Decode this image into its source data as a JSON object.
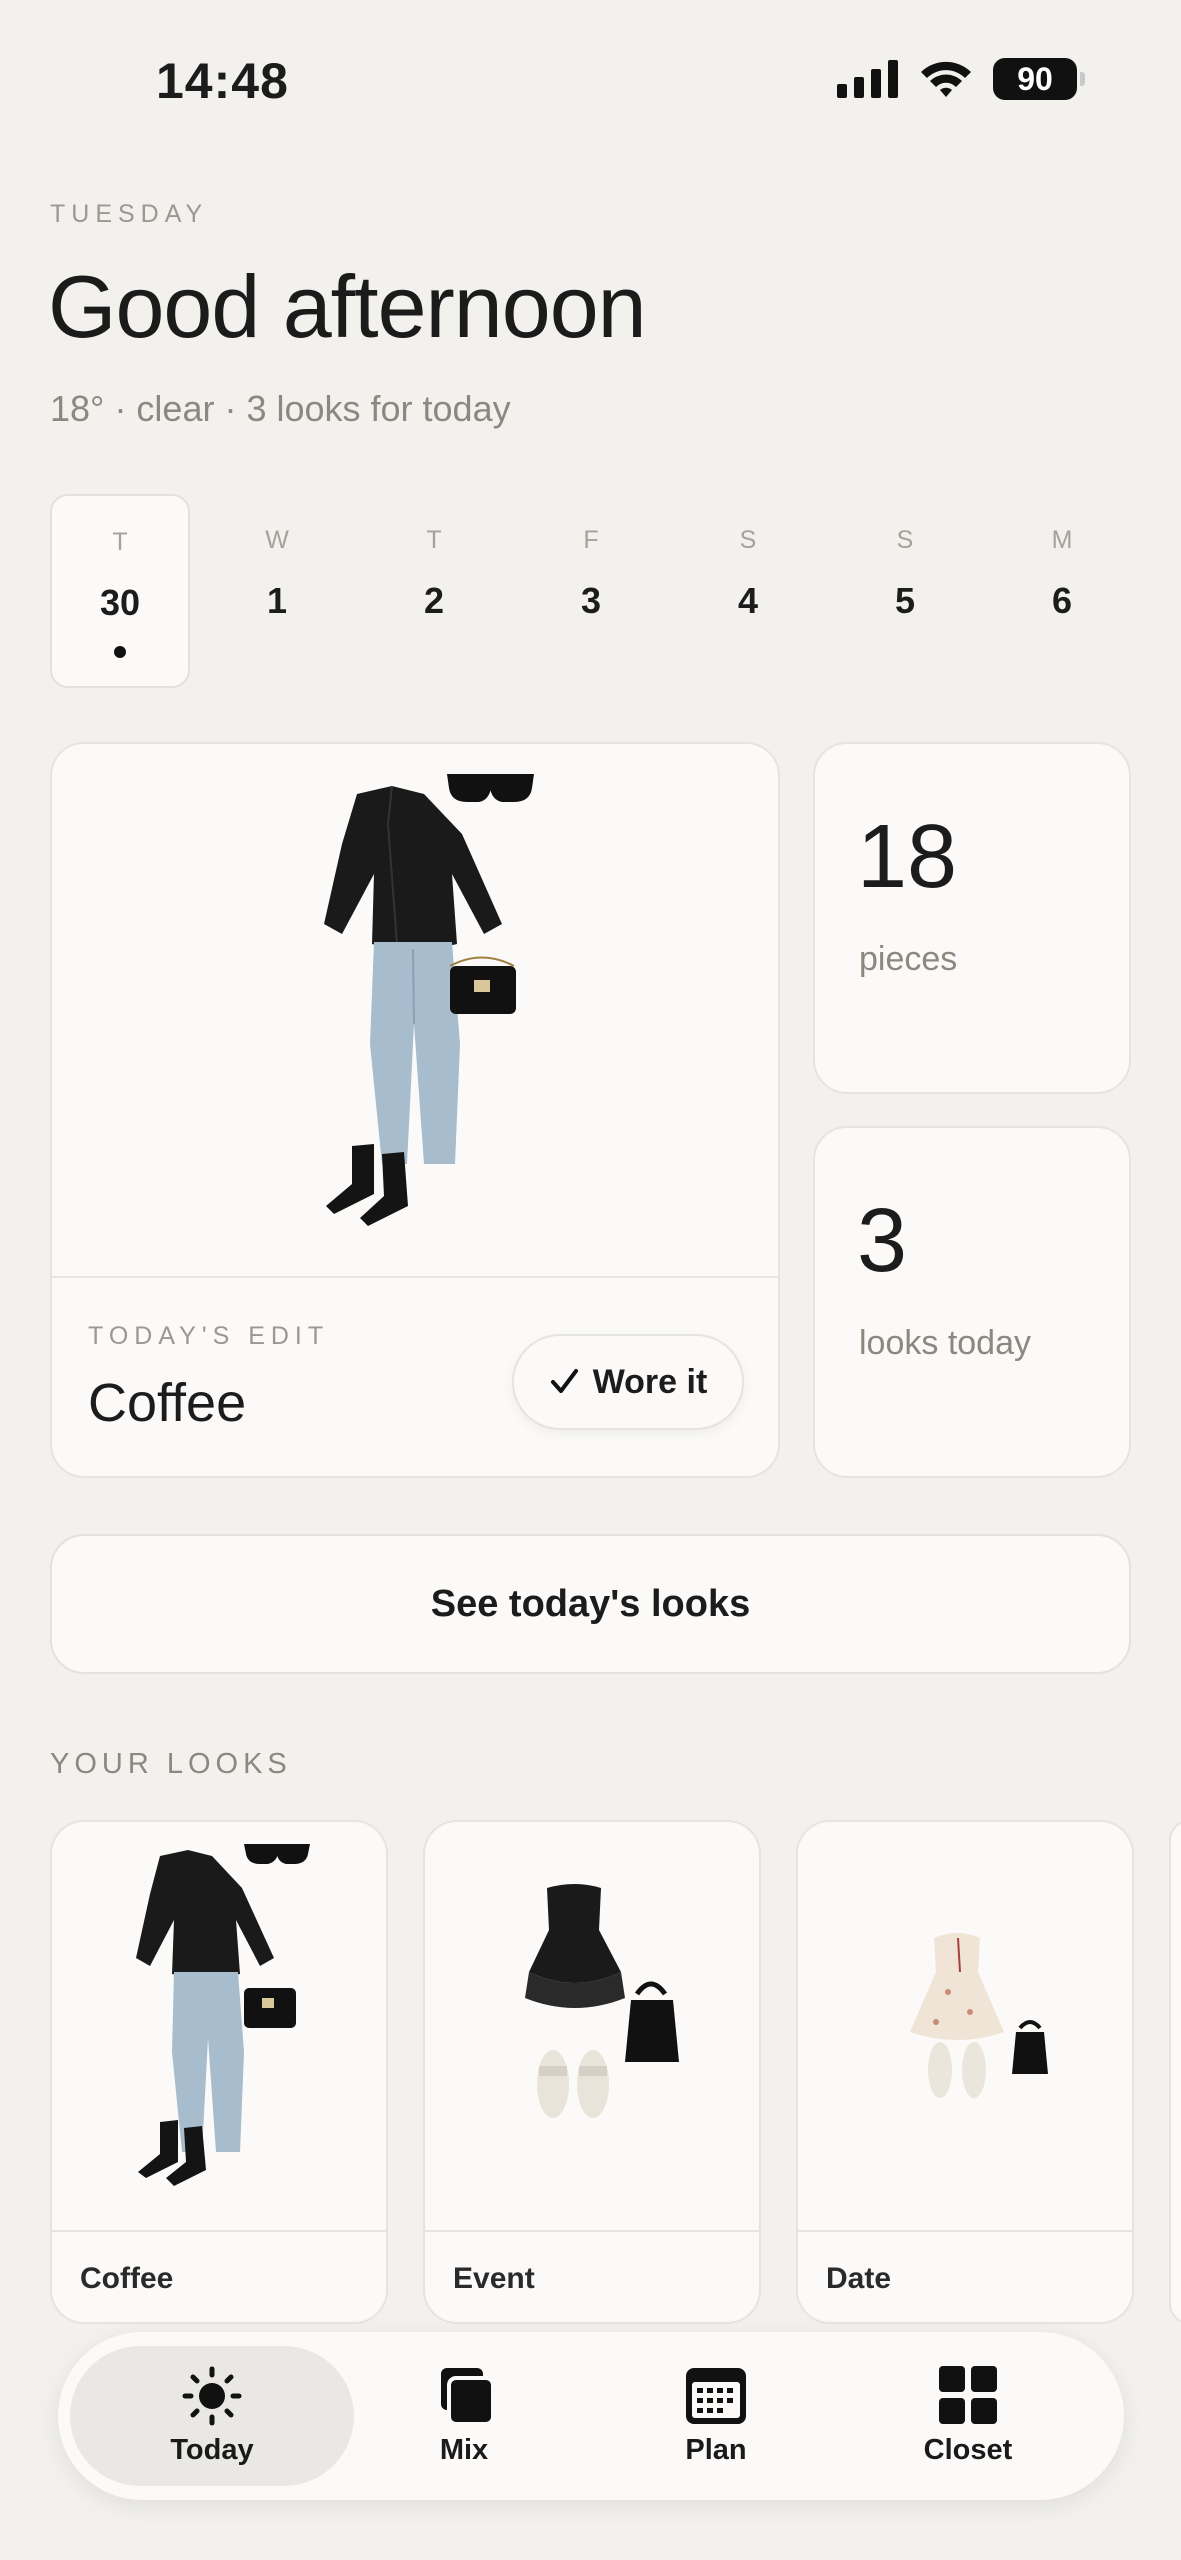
{
  "status_bar": {
    "time": "14:48",
    "battery": "90"
  },
  "header": {
    "day_name": "TUESDAY",
    "greeting": "Good afternoon",
    "subtitle": "18° · clear · 3 looks for today"
  },
  "week": [
    {
      "letter": "T",
      "num": "30",
      "selected": true
    },
    {
      "letter": "W",
      "num": "1"
    },
    {
      "letter": "T",
      "num": "2"
    },
    {
      "letter": "F",
      "num": "3"
    },
    {
      "letter": "S",
      "num": "4"
    },
    {
      "letter": "S",
      "num": "5"
    },
    {
      "letter": "M",
      "num": "6"
    }
  ],
  "hero": {
    "eyebrow": "TODAY'S EDIT",
    "title": "Coffee",
    "wore_label": "Wore it"
  },
  "stats": [
    {
      "value": "18",
      "label": "pieces"
    },
    {
      "value": "3",
      "label": "looks today"
    }
  ],
  "see_looks_label": "See today's looks",
  "your_looks": {
    "title": "YOUR LOOKS",
    "items": [
      {
        "name": "Coffee"
      },
      {
        "name": "Event"
      },
      {
        "name": "Date"
      }
    ]
  },
  "tabbar": {
    "items": [
      {
        "label": "Today",
        "icon": "sun-icon",
        "active": true
      },
      {
        "label": "Mix",
        "icon": "stack-icon"
      },
      {
        "label": "Plan",
        "icon": "calendar-icon"
      },
      {
        "label": "Closet",
        "icon": "grid-icon"
      }
    ]
  }
}
